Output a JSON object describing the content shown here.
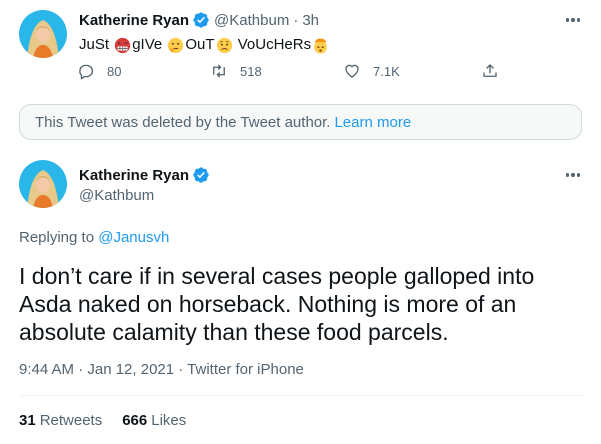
{
  "top_tweet": {
    "name": "Katherine Ryan",
    "handle": "@Kathbum",
    "separator": "·",
    "time": "3h",
    "text_segments": [
      "JuSt ",
      "gIVe ",
      "OuT",
      " VoUcHeRs"
    ],
    "emojis": [
      "angry-face-emoji",
      "thinking-face-emoji",
      "worried-face-emoji",
      "exploding-head-emoji"
    ],
    "reply_count": "80",
    "retweet_count": "518",
    "like_count": "7.1K"
  },
  "deleted_notice": {
    "text": "This Tweet was deleted by the Tweet author.",
    "link": "Learn more"
  },
  "main_tweet": {
    "name": "Katherine Ryan",
    "handle": "@Kathbum",
    "replying_prefix": "Replying to",
    "replying_to": "@Janusvh",
    "body": "I don’t care if in several cases people galloped into Asda naked on horseback. Nothing is more of an absolute calamity than these food parcels.",
    "meta": "9:44 AM · Jan 12, 2021 · Twitter for iPhone",
    "retweets_count": "31",
    "retweets_label": "Retweets",
    "likes_count": "666",
    "likes_label": "Likes"
  },
  "colors": {
    "accent": "#1d9bf0",
    "secondary_text": "#536471",
    "avatar_bg": "#29b6e8",
    "hair": "#e8c98a"
  }
}
